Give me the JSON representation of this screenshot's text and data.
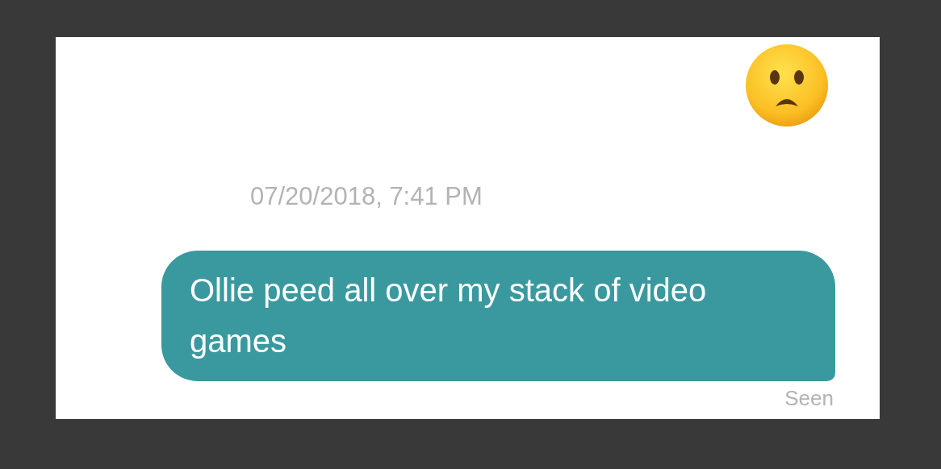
{
  "message": {
    "timestamp": "07/20/2018, 7:41 PM",
    "text": "Ollie peed all over my stack of video games",
    "status": "Seen"
  }
}
